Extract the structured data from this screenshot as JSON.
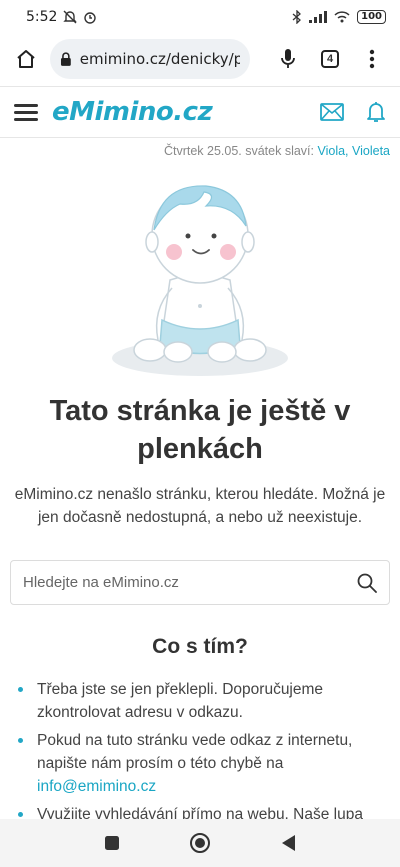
{
  "status_bar": {
    "time": "5:52",
    "battery": "100"
  },
  "browser": {
    "url": "emimino.cz/denicky/p",
    "tab_count": "4"
  },
  "header": {
    "logo": "eMimino.cz"
  },
  "date_line": {
    "text": "Čtvrtek 25.05. svátek slaví: ",
    "names": "Viola, Violeta"
  },
  "main": {
    "title": "Tato stránka je ještě v plenkách",
    "description": "eMimino.cz nenašlo stránku, kterou hledáte. Možná je jen dočasně nedostupná, a nebo už neexistuje.",
    "search_placeholder": "Hledejte na eMimino.cz",
    "section_title": "Co s tím?",
    "tips": [
      {
        "text": "Třeba jste se jen překlepli. Doporučujeme zkontrolovat adresu v odkazu."
      },
      {
        "text": "Pokud na tuto stránku vede odkaz z internetu, napište nám prosím o této chybě na ",
        "link": "info@emimino.cz"
      },
      {
        "text": "Využijte vyhledávání přímo na webu. Naše lupa"
      }
    ]
  },
  "colors": {
    "brand": "#22a7c6",
    "link": "#1aa6c4"
  }
}
